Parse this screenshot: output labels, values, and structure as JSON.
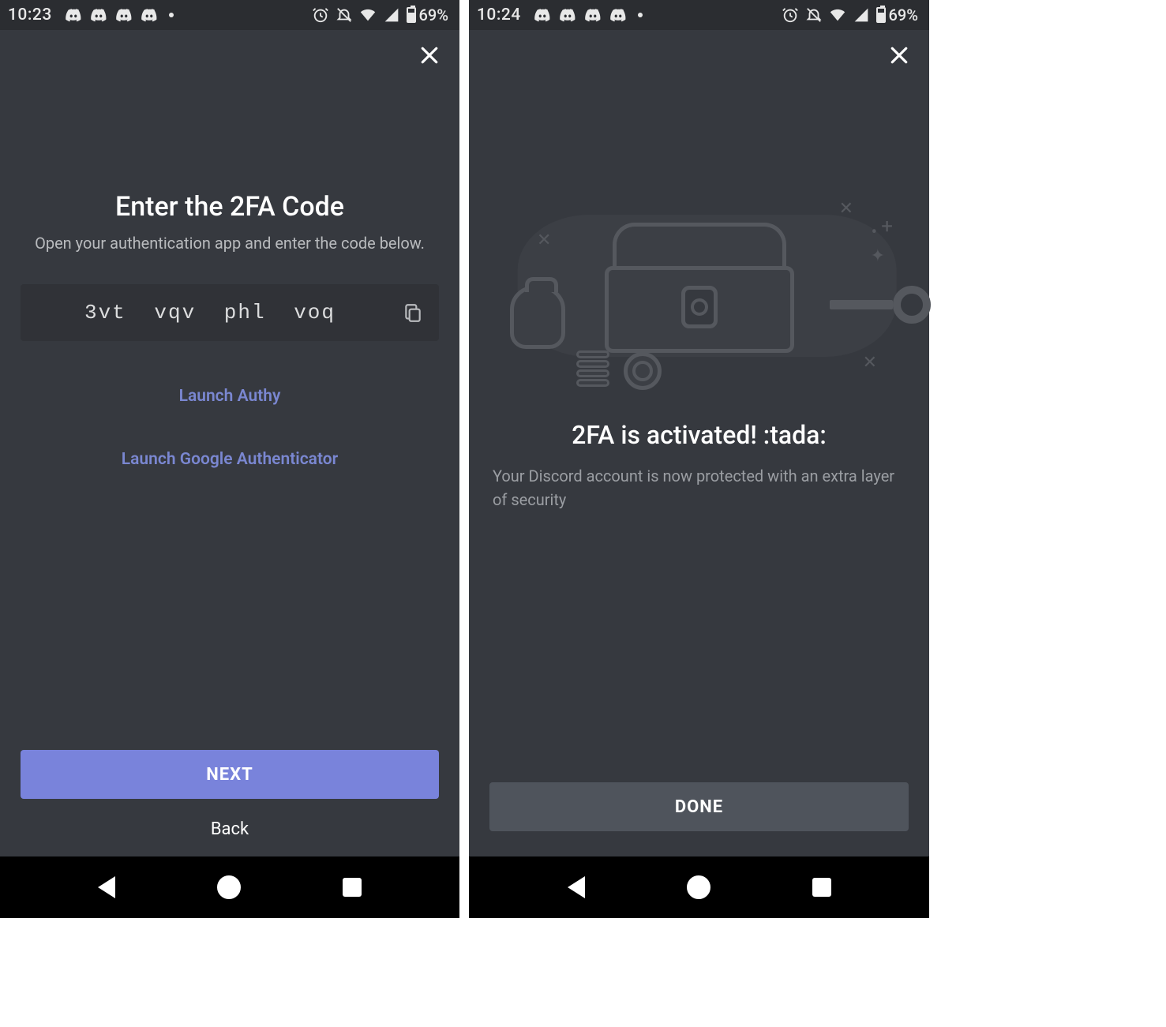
{
  "left": {
    "statusbar": {
      "time": "10:23",
      "battery_pct": "69%"
    },
    "title": "Enter the 2FA Code",
    "subtitle": "Open your authentication app and enter the code below.",
    "code": "3vt vqv phl voq",
    "launch_authy": "Launch Authy",
    "launch_google": "Launch Google Authenticator",
    "next_label": "NEXT",
    "back_label": "Back"
  },
  "right": {
    "statusbar": {
      "time": "10:24",
      "battery_pct": "69%"
    },
    "title": "2FA is activated! :tada:",
    "subtitle": "Your Discord account is now protected with an extra layer of security",
    "done_label": "DONE"
  }
}
